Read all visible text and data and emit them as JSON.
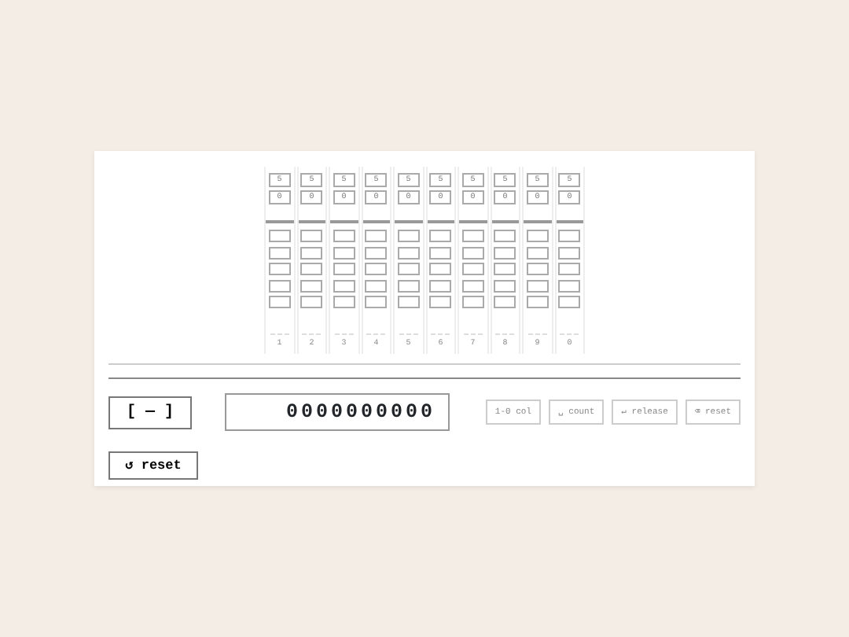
{
  "columns": [
    {
      "label": "1",
      "heaven": "5",
      "value": "0",
      "beads": [
        {
          "active": false
        },
        {
          "active": false
        },
        {
          "active": false
        },
        {
          "active": false
        },
        {
          "active": false
        }
      ]
    },
    {
      "label": "2",
      "heaven": "5",
      "value": "0",
      "beads": [
        {
          "active": false
        },
        {
          "active": false
        },
        {
          "active": false
        },
        {
          "active": false
        },
        {
          "active": false
        }
      ]
    },
    {
      "label": "3",
      "heaven": "5",
      "value": "0",
      "beads": [
        {
          "active": false
        },
        {
          "active": false
        },
        {
          "active": false
        },
        {
          "active": false
        },
        {
          "active": false
        }
      ]
    },
    {
      "label": "4",
      "heaven": "5",
      "value": "0",
      "beads": [
        {
          "active": false
        },
        {
          "active": false
        },
        {
          "active": false
        },
        {
          "active": false
        },
        {
          "active": false
        }
      ]
    },
    {
      "label": "5",
      "heaven": "5",
      "value": "0",
      "beads": [
        {
          "active": false
        },
        {
          "active": false
        },
        {
          "active": false
        },
        {
          "active": false
        },
        {
          "active": false
        }
      ]
    },
    {
      "label": "6",
      "heaven": "5",
      "value": "0",
      "beads": [
        {
          "active": false
        },
        {
          "active": false
        },
        {
          "active": false
        },
        {
          "active": false
        },
        {
          "active": false
        }
      ]
    },
    {
      "label": "7",
      "heaven": "5",
      "value": "0",
      "beads": [
        {
          "active": false
        },
        {
          "active": false
        },
        {
          "active": false
        },
        {
          "active": false
        },
        {
          "active": false
        }
      ]
    },
    {
      "label": "8",
      "heaven": "5",
      "value": "0",
      "beads": [
        {
          "active": false
        },
        {
          "active": false
        },
        {
          "active": false
        },
        {
          "active": false
        },
        {
          "active": false
        }
      ]
    },
    {
      "label": "9",
      "heaven": "5",
      "value": "0",
      "beads": [
        {
          "active": false
        },
        {
          "active": false
        },
        {
          "active": false
        },
        {
          "active": false
        },
        {
          "active": false
        }
      ]
    },
    {
      "label": "0",
      "heaven": "5",
      "value": "0",
      "beads": [
        {
          "active": false
        },
        {
          "active": false
        },
        {
          "active": false
        },
        {
          "active": false
        },
        {
          "active": false
        }
      ]
    }
  ],
  "toggle_button": "[ — ]",
  "display": "0000000000",
  "hints": [
    "1-0 col",
    "␣ count",
    "↵ release",
    "⌫ reset"
  ],
  "reset_button": "↺ reset"
}
